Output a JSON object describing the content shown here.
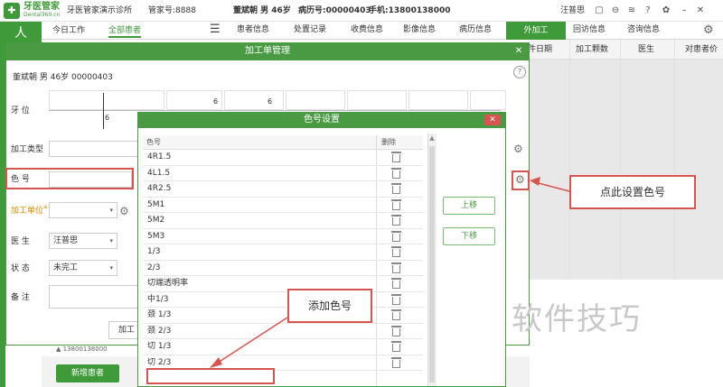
{
  "app": {
    "logo_char": "✚",
    "name": "牙医管家",
    "site": "Dental360.cn",
    "clinic": "牙医管家演示诊所",
    "manager": "管家号:8888",
    "patient_summary": "董斌朝 男 46岁",
    "record_no": "病历号:00000403",
    "phone": "手机:13800138000",
    "user": "汪普思"
  },
  "nav": {
    "avatar": "人",
    "tab_today": "今日工作",
    "tab_all": "全部患者",
    "menu": "☰",
    "tabs": [
      "患者信息",
      "处置记录",
      "收费信息",
      "影像信息",
      "病历信息"
    ],
    "tab_process": "外加工",
    "tab_return": "回访信息",
    "tab_consult": "咨询信息"
  },
  "bg_columns": [
    "件日期",
    "加工颗数",
    "医生",
    "对患者价"
  ],
  "bottom": {
    "phone": "▲ 13800138000",
    "new_patient": "新增患者"
  },
  "process_dialog": {
    "title": "加工单管理",
    "close": "✕",
    "patient": "董斌朝 男 46岁 00000403",
    "help": "?",
    "label_tooth": "牙    位",
    "tooth_value": "6",
    "label_type": "加工类型",
    "label_color": "色    号",
    "label_unit": "加工单位",
    "required_mark": "*",
    "label_doctor": "医    生",
    "doctor_value": "汪普思",
    "label_status": "状    态",
    "status_value": "未完工",
    "label_remark": "备    注",
    "bottom_btn": "加工"
  },
  "color_dialog": {
    "title": "色号设置",
    "close": "✕",
    "col_color": "色号",
    "col_delete": "删除",
    "rows": [
      "4R1.5",
      "4L1.5",
      "4R2.5",
      "5M1",
      "5M2",
      "5M3",
      "1/3",
      "2/3",
      "切端透明率",
      "中1/3",
      "颈 1/3",
      "颈 2/3",
      "切 1/3",
      "切 2/3"
    ],
    "move_up": "上移",
    "move_down": "下移"
  },
  "annotations": {
    "add_color": "添加色号",
    "click_set": "点此设置色号"
  },
  "watermark": "软件技巧",
  "colors": {
    "brand_green": "#3f9a3a",
    "highlight_red": "#d9534f"
  }
}
